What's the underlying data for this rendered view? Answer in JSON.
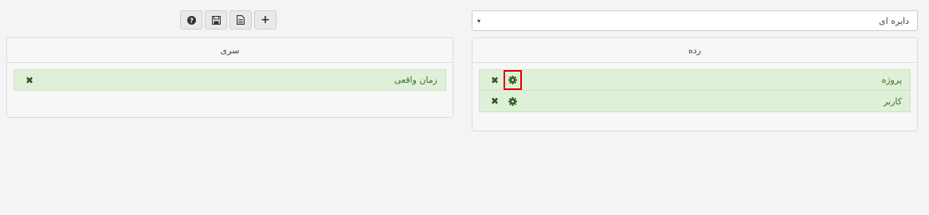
{
  "toolbar": {
    "buttons": [
      {
        "icon": "help-icon"
      },
      {
        "icon": "save-icon"
      },
      {
        "icon": "document-icon"
      },
      {
        "icon": "add-icon",
        "glyph": "+"
      }
    ]
  },
  "chart_type_select": {
    "value": "دایره ای",
    "caret": "▾"
  },
  "left_panel": {
    "title": "سری",
    "items": [
      {
        "label": "زمان واقعی",
        "remove_glyph": "✖"
      }
    ]
  },
  "right_panel": {
    "title": "رده",
    "items": [
      {
        "label": "پروژه",
        "remove_glyph": "✖",
        "highlighted": true
      },
      {
        "label": "کاربر",
        "remove_glyph": "✖",
        "highlighted": false
      }
    ]
  },
  "colors": {
    "row_bg": "#dff0d8",
    "row_text": "#3c6e2c",
    "highlight": "#e00000"
  }
}
